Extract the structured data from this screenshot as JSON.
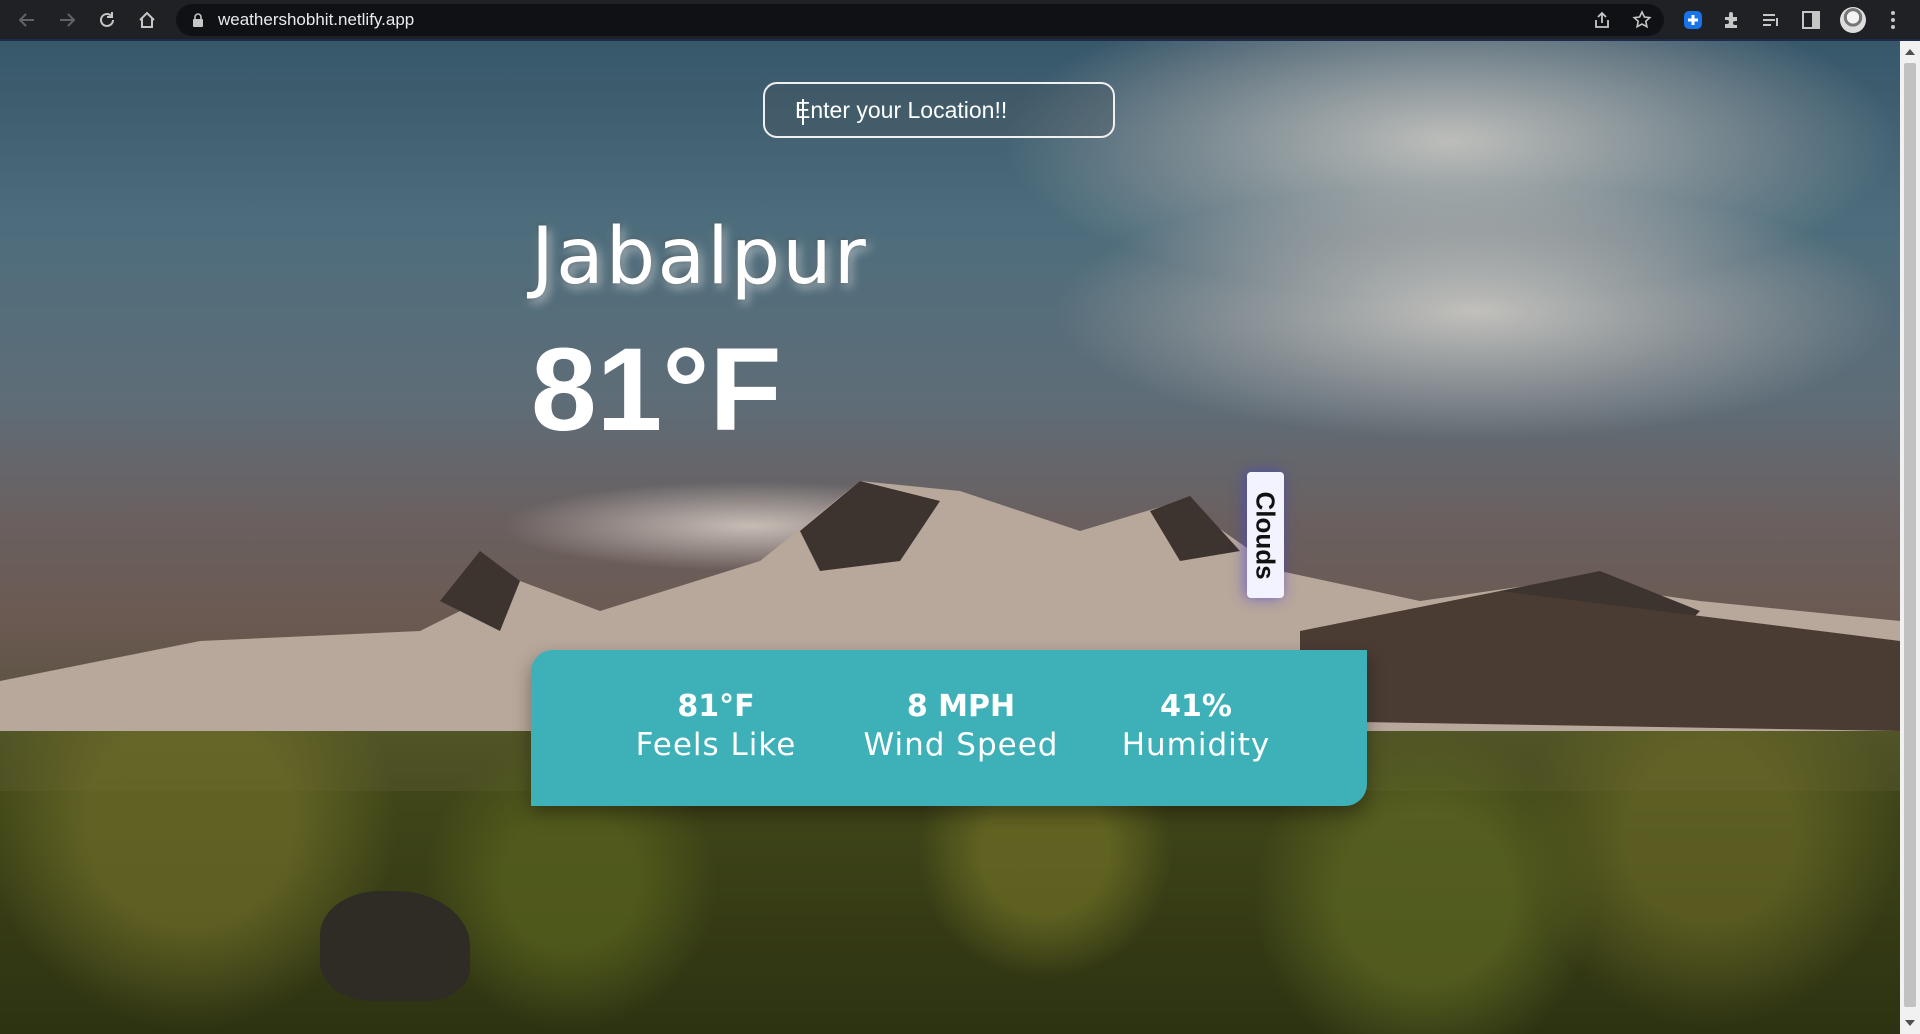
{
  "browser": {
    "url": "weathershobhit.netlify.app",
    "icons": {
      "back": "arrow-left-icon",
      "forward": "arrow-right-icon",
      "reload": "reload-icon",
      "home": "home-icon",
      "lock": "lock-icon",
      "share": "share-icon",
      "bookmark": "star-icon",
      "extensions": "puzzle-icon",
      "reading_list": "reading-list-icon",
      "side_panel": "side-panel-icon",
      "menu": "kebab-menu-icon"
    },
    "colors": {
      "chrome_bg": "#202124",
      "omnibox_bg": "#0f1115"
    }
  },
  "search": {
    "placeholder": "Enter your Location!!"
  },
  "weather": {
    "city": "Jabalpur",
    "temperature": "81°F",
    "condition": "Clouds"
  },
  "stats": [
    {
      "value": "81°F",
      "label": "Feels Like"
    },
    {
      "value": "8 MPH",
      "label": "Wind Speed"
    },
    {
      "value": "41%",
      "label": "Humidity"
    }
  ],
  "theme": {
    "stats_bg": "#3db0b8",
    "text": "#ffffff"
  }
}
